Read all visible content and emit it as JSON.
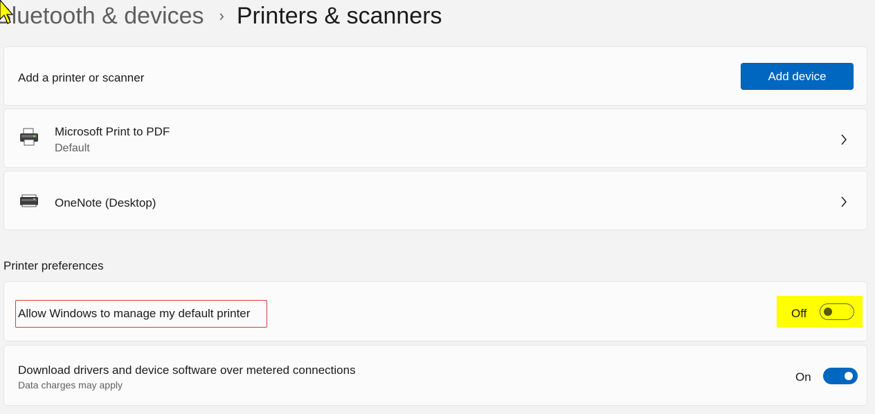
{
  "breadcrumb": {
    "parent": "Bluetooth & devices",
    "separator": "›",
    "current": "Printers & scanners"
  },
  "add_printer": {
    "label": "Add a printer or scanner",
    "button": "Add device"
  },
  "printers": [
    {
      "name": "Microsoft Print to PDF",
      "subtitle": "Default",
      "icon": "printer-icon"
    },
    {
      "name": "OneNote (Desktop)",
      "subtitle": "",
      "icon": "printer-icon"
    }
  ],
  "preferences": {
    "title": "Printer preferences",
    "items": [
      {
        "label": "Allow Windows to manage my default printer",
        "state_label": "Off",
        "on": false,
        "highlight": "#ffff00"
      },
      {
        "label": "Download drivers and device software over metered connections",
        "subtitle": "Data charges may apply",
        "state_label": "On",
        "on": true
      }
    ]
  },
  "colors": {
    "accent": "#0067c0",
    "highlight": "#ffff00",
    "outline": "#d63b3b"
  },
  "icons": [
    "chevron-right-icon",
    "printer-icon",
    "mouse-cursor-icon"
  ]
}
